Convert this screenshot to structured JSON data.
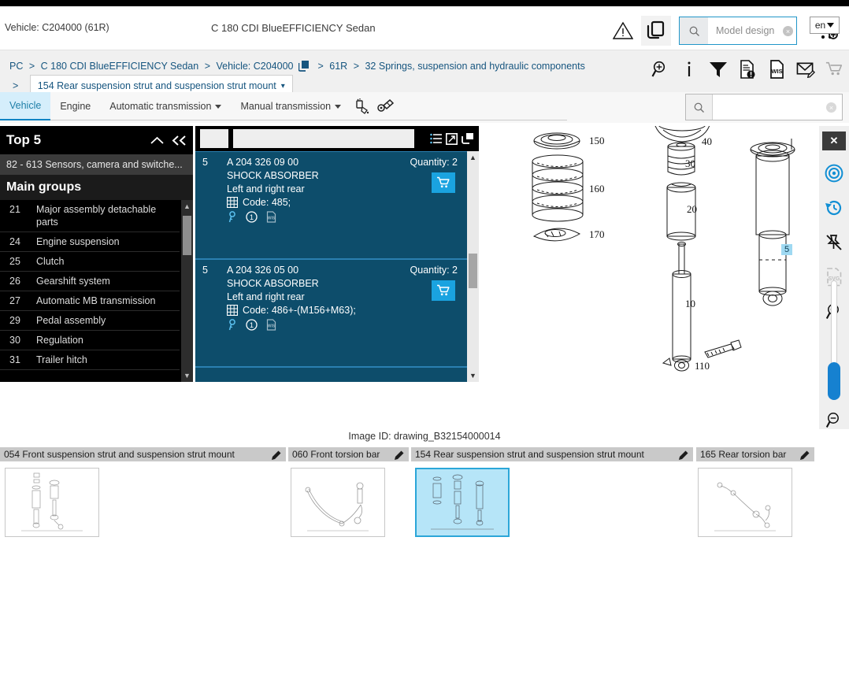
{
  "header": {
    "vehicle_id": "Vehicle: C204000 (61R)",
    "vehicle_model": "C 180 CDI BlueEFFICIENCY Sedan",
    "warning_icon": "warning-triangle-icon",
    "copy_icon": "copy-documents-icon",
    "model_search_icon": "search-icon",
    "model_search_placeholder": "Model design",
    "model_search_value": "",
    "model_chip_clear": "×",
    "cart_icon": "cart-add-icon",
    "language": "en",
    "language_caret": "⌄"
  },
  "breadcrumb": {
    "items": [
      "PC",
      "C 180 CDI BlueEFFICIENCY Sedan",
      "Vehicle: C204000",
      "61R",
      "32 Springs, suspension and hydraulic components"
    ],
    "separator": ">",
    "vehicle_copy_icon": "copy-icon",
    "selected": "154 Rear suspension strut and suspension strut mount",
    "selected_caret": "▾",
    "tools": [
      {
        "name": "zoom-search-icon",
        "label": "Search"
      },
      {
        "name": "info-icon",
        "label": "Information"
      },
      {
        "name": "filter-icon",
        "label": "Filter"
      },
      {
        "name": "document-alert-icon",
        "label": "Notes"
      },
      {
        "name": "wis-document-icon",
        "label": "WIS"
      },
      {
        "name": "mail-edit-icon",
        "label": "Feedback"
      },
      {
        "name": "cart-icon",
        "label": "Cart"
      }
    ]
  },
  "nav": {
    "tabs": [
      {
        "label": "Vehicle",
        "active": true,
        "dropdown": false
      },
      {
        "label": "Engine",
        "active": false,
        "dropdown": false
      },
      {
        "label": "Automatic transmission",
        "active": false,
        "dropdown": true
      },
      {
        "label": "Manual transmission",
        "active": false,
        "dropdown": true
      }
    ],
    "tool_icons": [
      "paint-spray-icon",
      "tools-icon"
    ],
    "search_icon": "search-icon",
    "search_value": "",
    "search_placeholder": "",
    "search_clear": "×"
  },
  "sidebar": {
    "top5_title": "Top 5",
    "collapse_up_icon": "chevron-up-icon",
    "collapse_left_icon": "double-chevron-left-icon",
    "top5_items": [
      "82 - 613 Sensors, camera and switche..."
    ],
    "main_groups_title": "Main groups",
    "groups": [
      {
        "num": "21",
        "label": "Major assembly detachable parts"
      },
      {
        "num": "24",
        "label": "Engine suspension"
      },
      {
        "num": "25",
        "label": "Clutch"
      },
      {
        "num": "26",
        "label": "Gearshift system"
      },
      {
        "num": "27",
        "label": "Automatic MB transmission"
      },
      {
        "num": "29",
        "label": "Pedal assembly"
      },
      {
        "num": "30",
        "label": "Regulation"
      },
      {
        "num": "31",
        "label": "Trailer hitch"
      }
    ],
    "scroll_up": "▲",
    "scroll_down": "▼"
  },
  "parts_panel": {
    "toolbar_icons": [
      "list-view-icon",
      "expand-icon",
      "popout-icon"
    ],
    "filter_value": "",
    "rows": [
      {
        "index": "5",
        "part_number": "A 204 326 09 00",
        "description": "SHOCK ABSORBER",
        "position": "Left and right rear",
        "code_label": "Code: 485;",
        "code_icon": "table-grid-icon",
        "quantity_label": "Quantity: 2",
        "cart_icon": "cart-icon",
        "mini_icons": [
          "key-icon",
          "info-circle-icon",
          "wis-doc-icon"
        ]
      },
      {
        "index": "5",
        "part_number": "A 204 326 05 00",
        "description": "SHOCK ABSORBER",
        "position": "Left and right rear",
        "code_label": "Code: 486+-(M156+M63);",
        "code_icon": "table-grid-icon",
        "quantity_label": "Quantity: 2",
        "cart_icon": "cart-icon",
        "mini_icons": [
          "key-icon",
          "info-circle-icon",
          "wis-doc-icon"
        ]
      }
    ],
    "scroll_up": "▲",
    "scroll_down": "▼"
  },
  "drawing": {
    "image_id": "Image ID: drawing_B32154000014",
    "callouts": [
      "150",
      "160",
      "170",
      "40",
      "30",
      "20",
      "10",
      "110"
    ],
    "highlight_callout": "5",
    "toolbar": [
      {
        "name": "close-drawing-icon",
        "glyph": "✕"
      },
      {
        "name": "target-icon",
        "glyph": "◎"
      },
      {
        "name": "history-reset-icon",
        "glyph": "↺"
      },
      {
        "name": "unpin-icon",
        "glyph": "✗"
      },
      {
        "name": "svg-export-icon",
        "glyph": "SVG"
      },
      {
        "name": "zoom-in-icon",
        "glyph": "+"
      },
      {
        "name": "zoom-out-icon",
        "glyph": "−"
      }
    ]
  },
  "thumbnails": [
    {
      "caption": "054 Front suspension strut and suspension strut mount",
      "edit_icon": "edit-icon",
      "selected": false
    },
    {
      "caption": "060 Front torsion bar",
      "edit_icon": "edit-icon",
      "selected": false
    },
    {
      "caption": "154 Rear suspension strut and suspension strut mount",
      "edit_icon": "edit-icon",
      "selected": true
    },
    {
      "caption": "165 Rear torsion bar",
      "edit_icon": "edit-icon",
      "selected": false
    }
  ],
  "colors": {
    "accent_blue": "#1aa3e0",
    "row_bg": "#0d4d6b",
    "selected_tab": "#d5eefb",
    "crumb_text": "#16557f"
  }
}
